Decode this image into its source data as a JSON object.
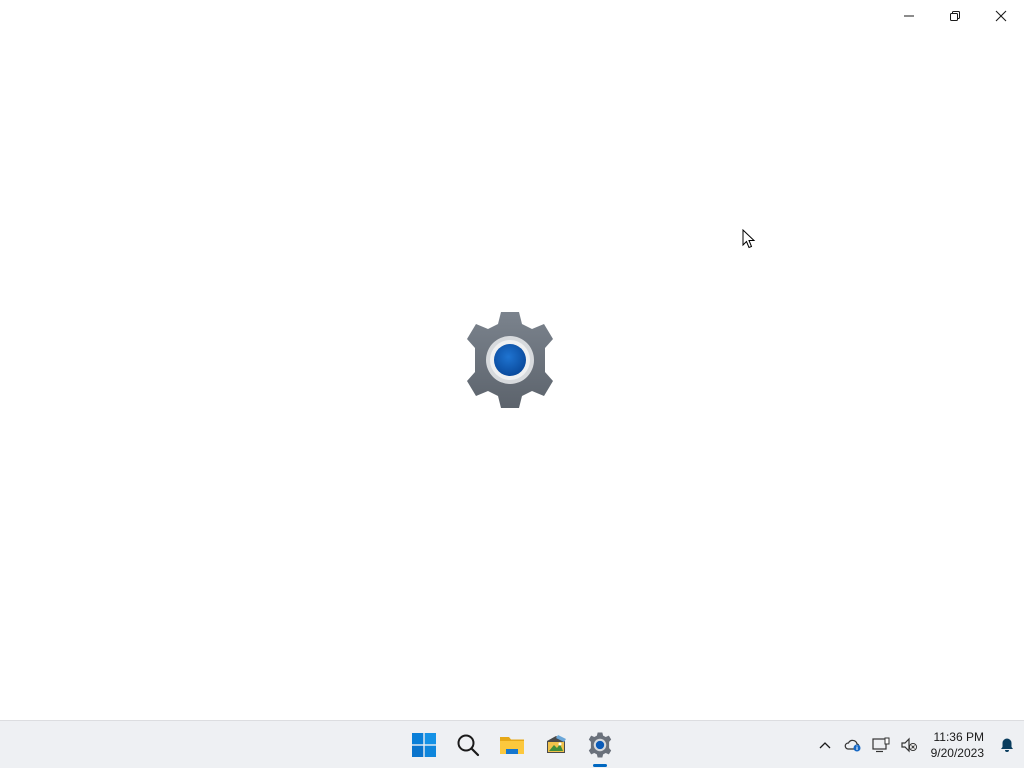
{
  "window": {
    "caption_buttons": [
      {
        "name": "minimize",
        "icon": "minimize-icon"
      },
      {
        "name": "restore",
        "icon": "restore-icon"
      },
      {
        "name": "close",
        "icon": "close-icon"
      }
    ],
    "splash_icon": "settings-gear-icon"
  },
  "taskbar": {
    "apps": [
      {
        "name": "start",
        "icon": "windows-logo-icon"
      },
      {
        "name": "search",
        "icon": "search-icon"
      },
      {
        "name": "file-explorer",
        "icon": "folder-icon"
      },
      {
        "name": "photo-app",
        "icon": "photo-app-icon"
      },
      {
        "name": "settings",
        "icon": "settings-gear-icon",
        "active": true
      }
    ],
    "tray": {
      "icons": [
        "chevron-up-icon",
        "onedrive-icon",
        "network-icon",
        "speaker-muted-icon"
      ],
      "time": "11:36 PM",
      "date": "9/20/2023",
      "notification_icon": "bell-icon"
    }
  },
  "colors": {
    "accent": "#0067c0",
    "gear_gray": "#6e7580",
    "taskbar_bg": "#eef0f3"
  }
}
